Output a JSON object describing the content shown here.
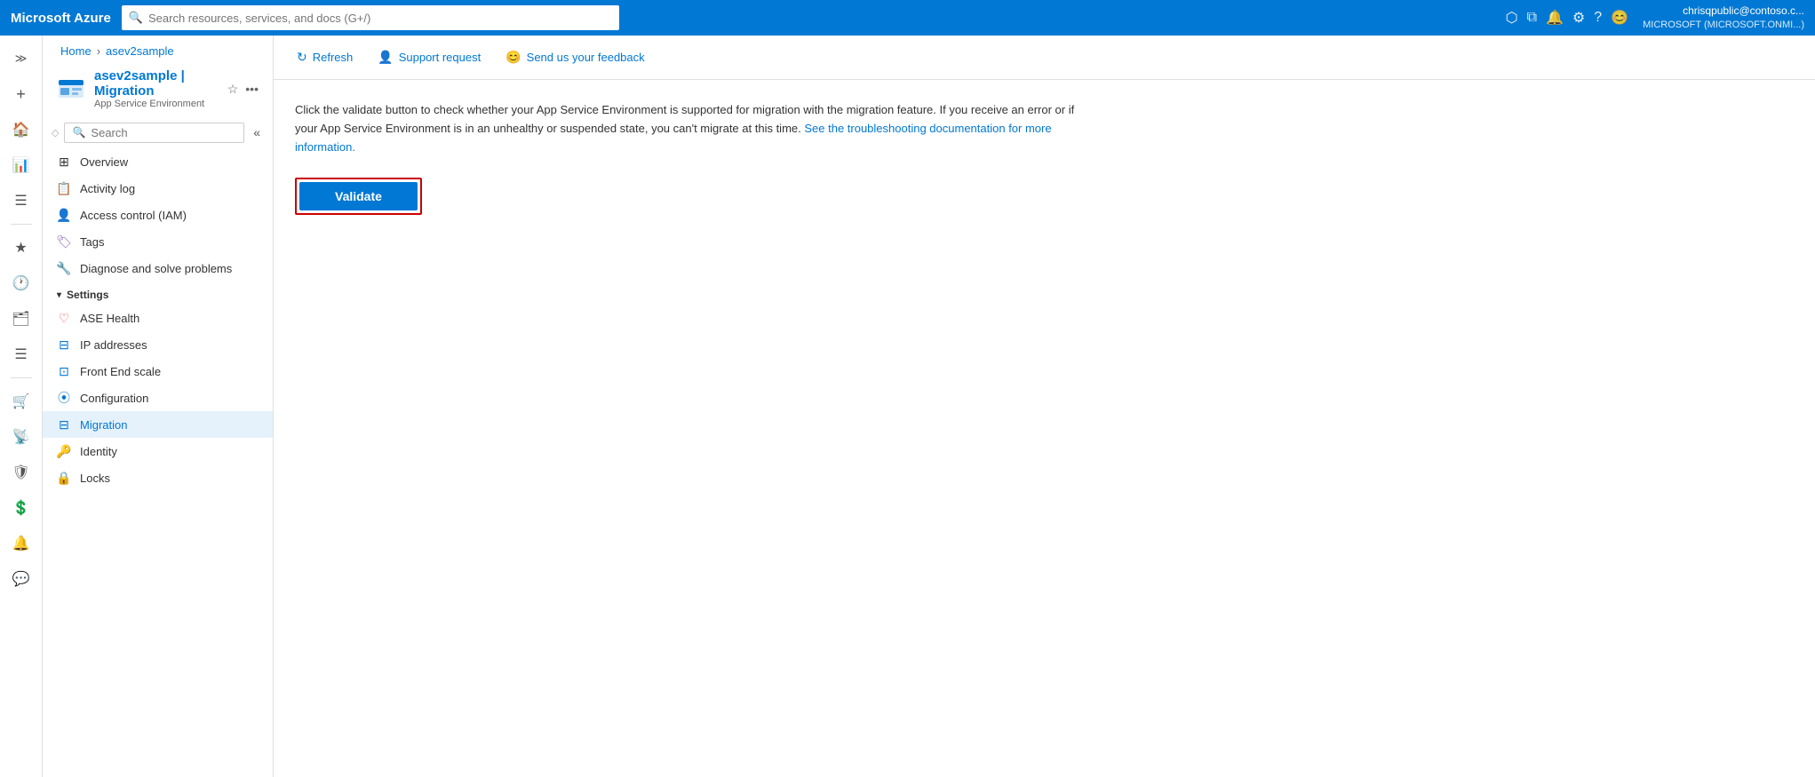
{
  "topbar": {
    "logo": "Microsoft Azure",
    "search_placeholder": "Search resources, services, and docs (G+/)",
    "user_name": "chrisqpublic@contoso.c...",
    "user_tenant": "MICROSOFT (MICROSOFT.ONMI...)"
  },
  "breadcrumb": {
    "home": "Home",
    "resource": "asev2sample"
  },
  "page_header": {
    "title": "asev2sample | Migration",
    "subtitle": "App Service Environment",
    "favorite_tooltip": "Add to favorites",
    "more_tooltip": "More"
  },
  "sidebar": {
    "search_placeholder": "Search",
    "items": [
      {
        "id": "overview",
        "label": "Overview",
        "icon": "⊞"
      },
      {
        "id": "activity-log",
        "label": "Activity log",
        "icon": "📋"
      },
      {
        "id": "access-control",
        "label": "Access control (IAM)",
        "icon": "👤"
      },
      {
        "id": "tags",
        "label": "Tags",
        "icon": "🏷"
      },
      {
        "id": "diagnose",
        "label": "Diagnose and solve problems",
        "icon": "🔧"
      }
    ],
    "settings_section": "Settings",
    "settings_items": [
      {
        "id": "ase-health",
        "label": "ASE Health",
        "icon": "♡"
      },
      {
        "id": "ip-addresses",
        "label": "IP addresses",
        "icon": "⊟"
      },
      {
        "id": "front-end-scale",
        "label": "Front End scale",
        "icon": "⊡"
      },
      {
        "id": "configuration",
        "label": "Configuration",
        "icon": "|||"
      },
      {
        "id": "migration",
        "label": "Migration",
        "icon": "⊟",
        "active": true
      },
      {
        "id": "identity",
        "label": "Identity",
        "icon": "🔑"
      },
      {
        "id": "locks",
        "label": "Locks",
        "icon": "🔒"
      }
    ]
  },
  "toolbar": {
    "refresh_label": "Refresh",
    "support_label": "Support request",
    "feedback_label": "Send us your feedback"
  },
  "content": {
    "description_part1": "Click the validate button to check whether your App Service Environment is supported for migration with the migration feature. If you receive an error or if your App Service Environment is in an unhealthy or suspended state, you can't migrate at this time.",
    "description_link_text": "See the troubleshooting documentation for more information.",
    "validate_button_label": "Validate"
  }
}
